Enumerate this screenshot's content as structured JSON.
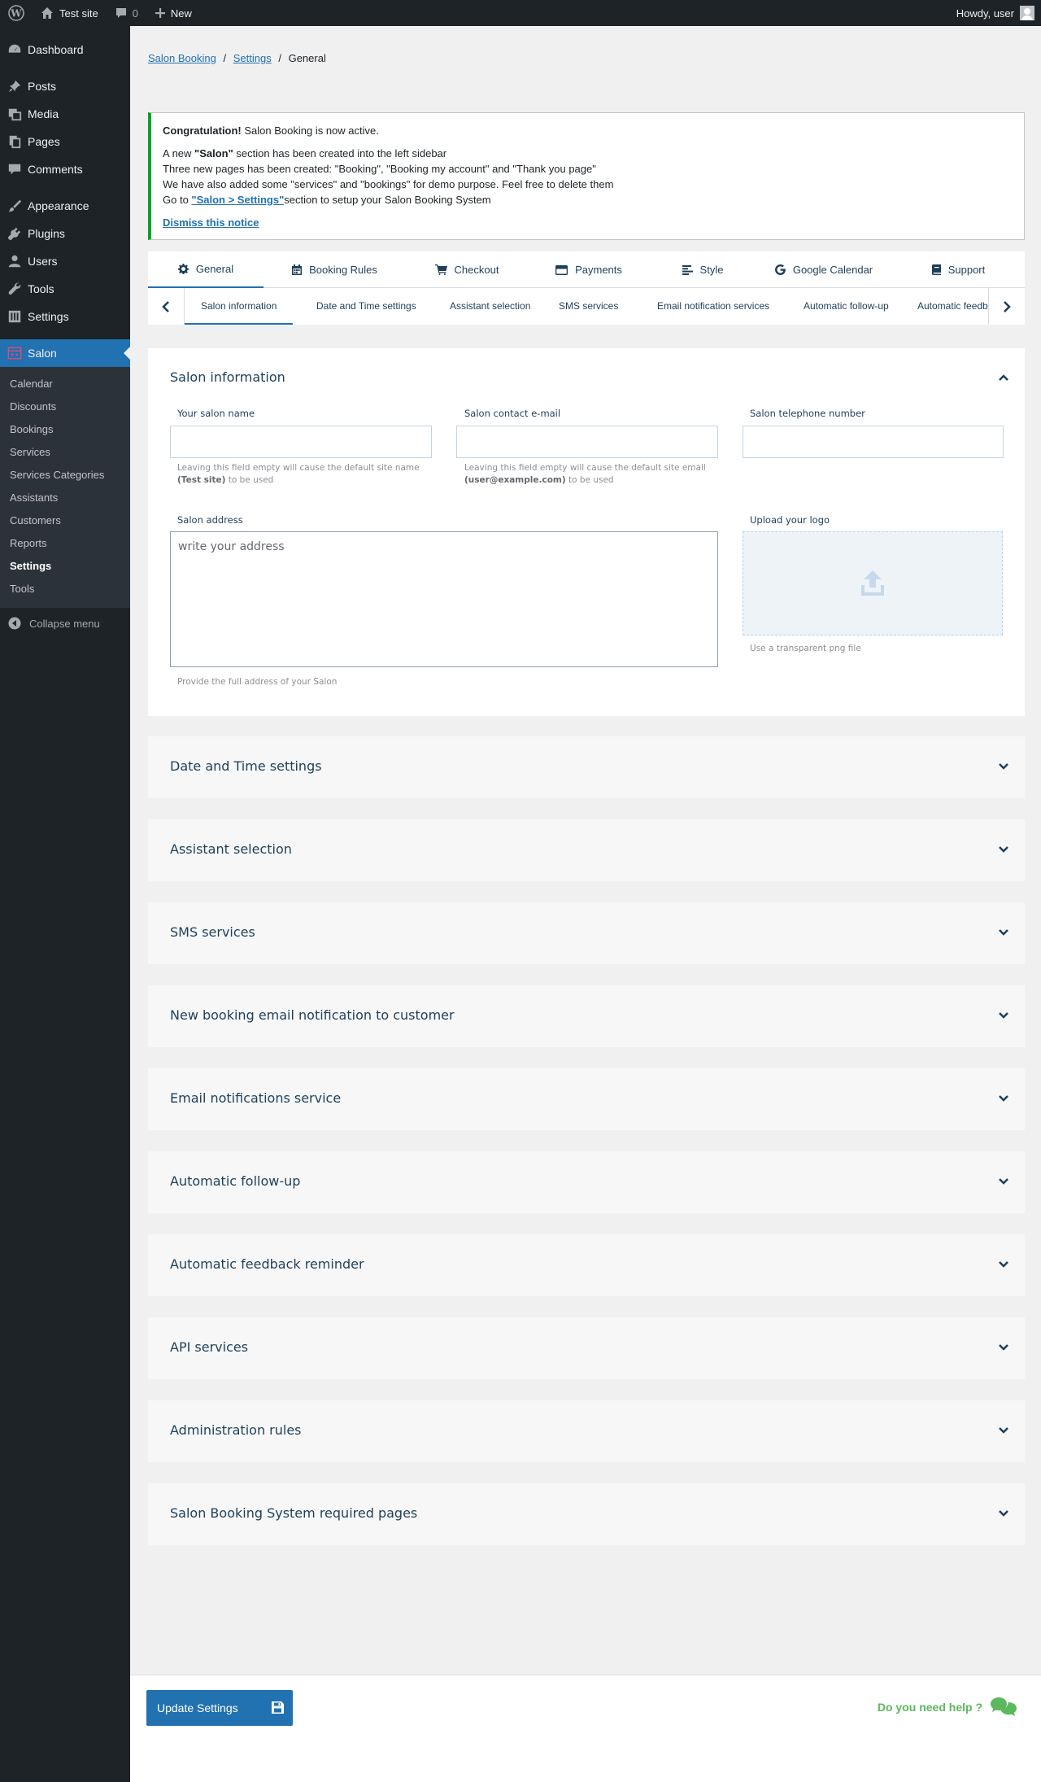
{
  "admin_bar": {
    "site_name": "Test site",
    "comments_count": "0",
    "new_label": "New",
    "greeting": "Howdy, user"
  },
  "sidebar": {
    "items": [
      {
        "label": "Dashboard",
        "icon": "dashboard-icon"
      },
      {
        "label": "Posts",
        "icon": "pin-icon"
      },
      {
        "label": "Media",
        "icon": "media-icon"
      },
      {
        "label": "Pages",
        "icon": "page-icon"
      },
      {
        "label": "Comments",
        "icon": "comment-icon"
      },
      {
        "label": "Appearance",
        "icon": "brush-icon"
      },
      {
        "label": "Plugins",
        "icon": "plug-icon"
      },
      {
        "label": "Users",
        "icon": "user-icon"
      },
      {
        "label": "Tools",
        "icon": "wrench-icon"
      },
      {
        "label": "Settings",
        "icon": "settings-icon"
      },
      {
        "label": "Salon",
        "icon": "salon-icon"
      }
    ],
    "submenu": [
      "Calendar",
      "Discounts",
      "Bookings",
      "Services",
      "Services Categories",
      "Assistants",
      "Customers",
      "Reports",
      "Settings",
      "Tools"
    ],
    "collapse_label": "Collapse menu"
  },
  "breadcrumb": {
    "link1": "Salon Booking",
    "link2": "Settings",
    "current": "General",
    "sep": "/"
  },
  "notice": {
    "title_bold": "Congratulation!",
    "title_rest": " Salon Booking is now active.",
    "line1_a": "A new ",
    "line1_b": "\"Salon\"",
    "line1_c": " section has been created into the left sidebar",
    "line2": "Three new pages has been created: \"Booking\", \"Booking my account\" and \"Thank you page\"",
    "line3": "We have also added some \"services\" and \"bookings\" for demo purpose. Feel free to delete them",
    "line4_a": "Go to ",
    "line4_link": "\"Salon > Settings\"",
    "line4_b": "section to setup your Salon Booking System",
    "dismiss": "Dismiss this notice"
  },
  "tabs": [
    {
      "label": "General",
      "icon": "gear-icon"
    },
    {
      "label": "Booking Rules",
      "icon": "calendar-icon"
    },
    {
      "label": "Checkout",
      "icon": "cart-icon"
    },
    {
      "label": "Payments",
      "icon": "credit-card-icon"
    },
    {
      "label": "Style",
      "icon": "align-left-icon"
    },
    {
      "label": "Google Calendar",
      "icon": "google-icon"
    },
    {
      "label": "Support",
      "icon": "book-icon"
    }
  ],
  "subtabs": [
    "Salon information",
    "Date and Time settings",
    "Assistant selection",
    "SMS services",
    "Email notification services",
    "Automatic follow-up",
    "Automatic feedback reminder"
  ],
  "salon_info": {
    "title": "Salon information",
    "name_label": "Your salon name",
    "name_hint_a": "Leaving this field empty will cause the default site name",
    "name_hint_b": "(Test site)",
    "name_hint_c": " to be used",
    "email_label": "Salon contact e-mail",
    "email_hint_a": "Leaving this field empty will cause the default site email",
    "email_hint_b": "(user@example.com)",
    "email_hint_c": " to be used",
    "phone_label": "Salon telephone number",
    "address_label": "Salon address",
    "address_placeholder": "write your address",
    "address_hint": "Provide the full address of your Salon",
    "logo_label": "Upload your logo",
    "logo_hint": "Use a transparent png file"
  },
  "sections": [
    "Date and Time settings",
    "Assistant selection",
    "SMS services",
    "New booking email notification to customer",
    "Email notifications service",
    "Automatic follow-up",
    "Automatic feedback reminder",
    "API services",
    "Administration rules",
    "Salon Booking System required pages"
  ],
  "footer": {
    "update_button": "Update Settings",
    "help_text": "Do you need help ?"
  },
  "colors": {
    "accent": "#2271b1",
    "notice_border": "#00a32a",
    "help": "#5cb85c"
  }
}
